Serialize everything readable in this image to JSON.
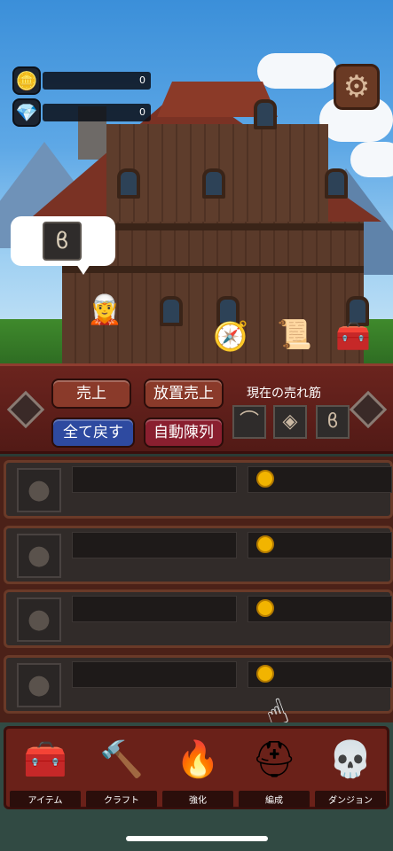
{
  "hud": {
    "coins": {
      "icon": "gold-coin-icon",
      "value": "0"
    },
    "gems": {
      "icon": "diamond-icon",
      "value": "0"
    },
    "settings_icon": "gear-icon"
  },
  "speech_bubble": {
    "item_icon": "pouch-icon"
  },
  "shop_panel": {
    "buttons": {
      "sell": "売上",
      "idle_sales": "放置売上",
      "return_all": "全て戻す",
      "auto_display": "自動陳列"
    },
    "trend_title": "現在の売れ筋",
    "trend_items": [
      "bow-icon",
      "shield-icon",
      "pouch-icon"
    ]
  },
  "rows": [
    {
      "icon": "bag-icon",
      "name": "",
      "price": ""
    },
    {
      "icon": "bag-icon",
      "name": "",
      "price": ""
    },
    {
      "icon": "bag-icon",
      "name": "",
      "price": ""
    },
    {
      "icon": "bag-icon",
      "name": "",
      "price": ""
    }
  ],
  "nav": [
    {
      "label": "アイテム",
      "icon": "treasure-chest-icon"
    },
    {
      "label": "クラフト",
      "icon": "hammer-icon"
    },
    {
      "label": "強化",
      "icon": "fire-orb-icon"
    },
    {
      "label": "編成",
      "icon": "helmet-icon"
    },
    {
      "label": "ダンジョン",
      "icon": "skull-icon"
    }
  ],
  "colors": {
    "panel": "#6b241e",
    "button_blue": "#2e4aa0",
    "button_red": "#8a1f2f",
    "coin": "#f2b400"
  }
}
